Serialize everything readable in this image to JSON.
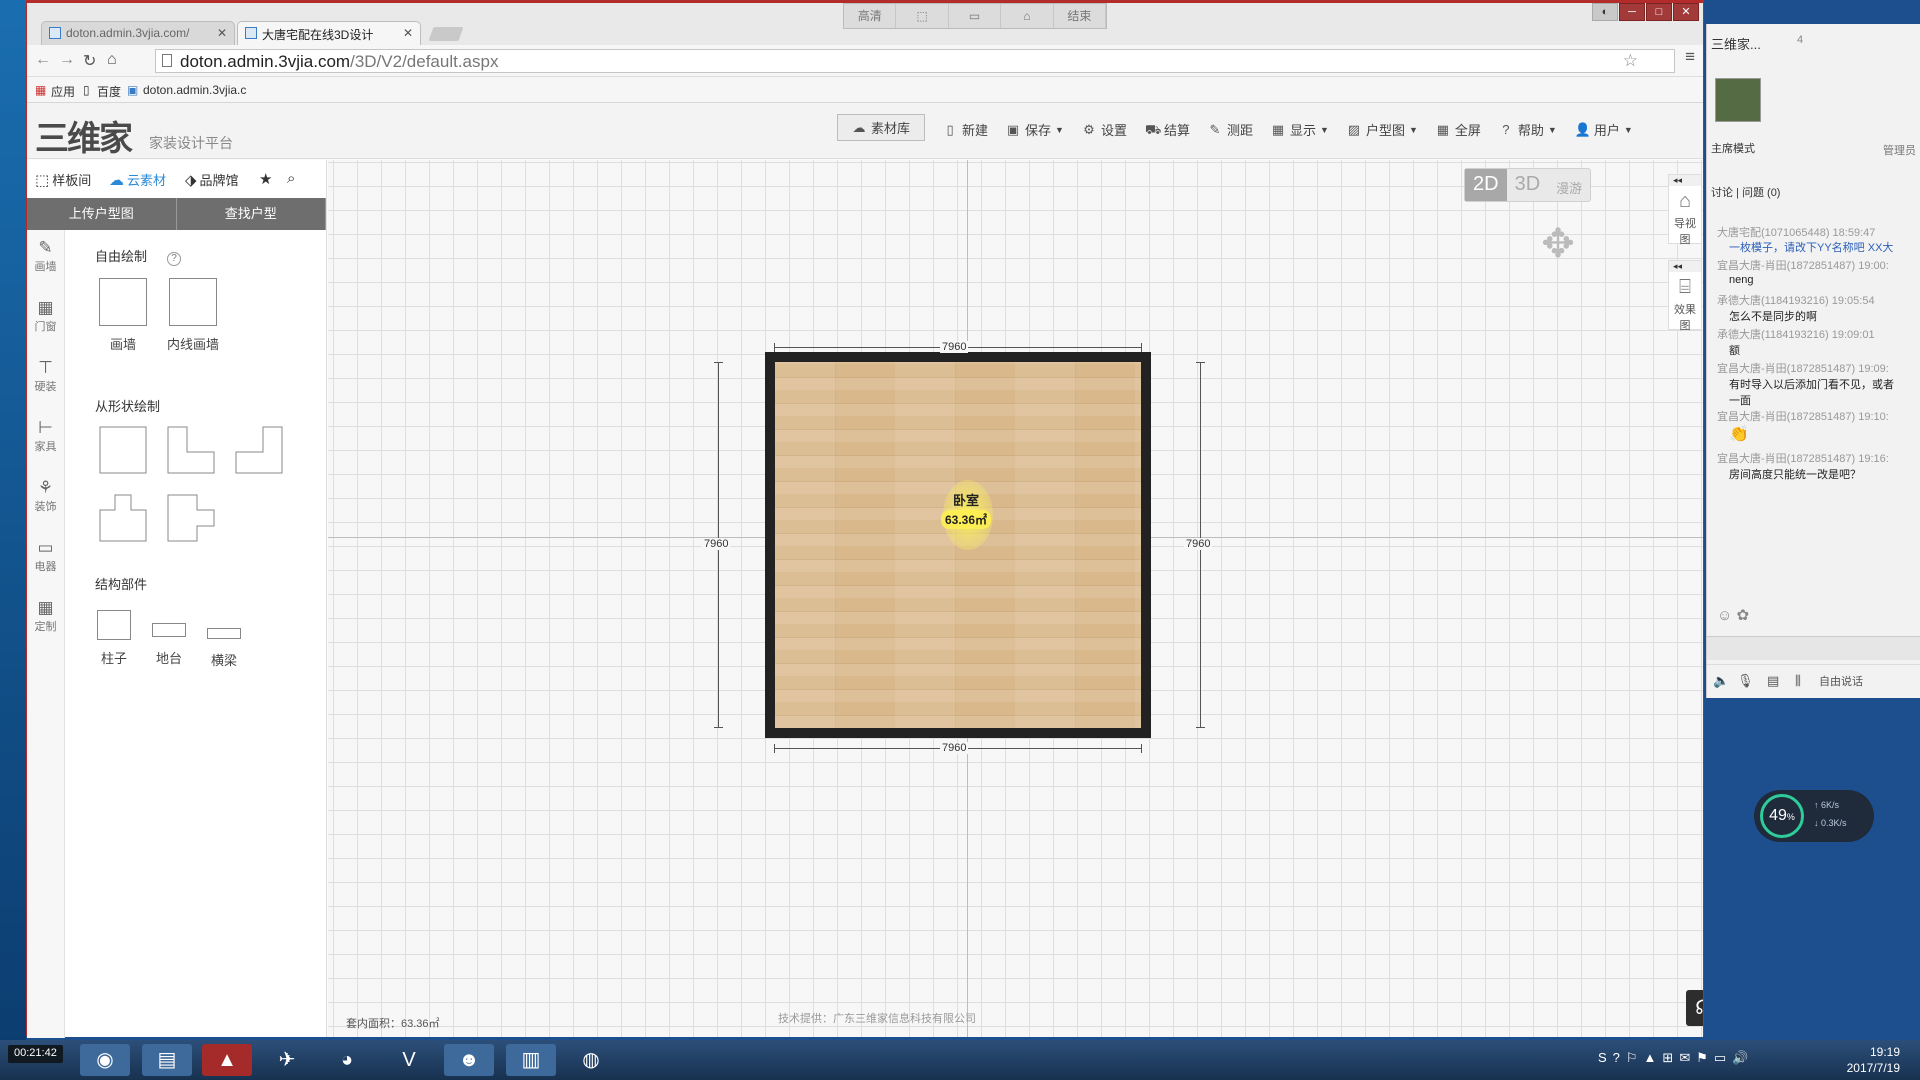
{
  "browser": {
    "tabs": [
      {
        "title": "doton.admin.3vjia.com/"
      },
      {
        "title": "大唐宅配在线3D设计"
      }
    ],
    "record_bar": [
      "高清",
      "",
      "",
      "",
      "结束"
    ],
    "url_host": "doton.admin.3vjia.com",
    "url_path": "/3D/V2/default.aspx",
    "bookmarks": {
      "apps": "应用",
      "baidu": "百度",
      "site": "doton.admin.3vjia.c"
    }
  },
  "app": {
    "logo": "三维家",
    "subtitle": "家装设计平台",
    "toolbar": {
      "library": "素材库",
      "new": "新建",
      "save": "保存",
      "settings": "设置",
      "checkout": "结算",
      "measure": "测距",
      "display": "显示",
      "floorplan": "户型图",
      "fullscreen": "全屏",
      "help": "帮助",
      "user": "用户"
    },
    "left_tabs": {
      "samples": "样板间",
      "cloud": "云素材",
      "brands": "品牌馆"
    },
    "left_buttons": {
      "upload": "上传户型图",
      "find": "查找户型"
    },
    "side_menu": [
      "画墙",
      "门窗",
      "硬装",
      "家具",
      "装饰",
      "电器",
      "定制"
    ],
    "sections": {
      "free_draw": "自由绘制",
      "help_mark": "?",
      "draw_wall": "画墙",
      "inner_wall": "内线画墙",
      "shape_draw": "从形状绘制",
      "structure": "结构部件",
      "pillar": "柱子",
      "platform": "地台",
      "beam": "横梁"
    }
  },
  "canvas": {
    "view_modes": {
      "d2": "2D",
      "d3": "3D",
      "roam": "漫游"
    },
    "room_name": "卧室",
    "room_area": "63.36㎡",
    "dimensions": {
      "top": "7960",
      "bottom": "7960",
      "left": "7960",
      "right": "7960"
    },
    "nav_view": "导视图",
    "render_view": "效果图",
    "area_status": "套内面积：63.36㎡",
    "credit": "技术提供：广东三维家信息科技有限公司"
  },
  "chat": {
    "title": "三维家...",
    "count": "4",
    "mode": "主席模式",
    "admin": "管理员",
    "tabs": "讨论 | 问题 (0)",
    "messages": [
      {
        "meta": "大唐宅配(1071065448) 18:59:47",
        "text": "一枚模子，请改下YY名称吧 XX大"
      },
      {
        "meta": "宜昌大唐-肖田(1872851487) 19:00:",
        "text": "neng"
      },
      {
        "meta": "承德大唐(1184193216) 19:05:54",
        "text": "怎么不是同步的啊"
      },
      {
        "meta": "承德大唐(1184193216) 19:09:01",
        "text": "额"
      },
      {
        "meta": "宜昌大唐-肖田(1872851487) 19:09:",
        "text": "有时导入以后添加门看不见，或者"
      },
      {
        "meta": "",
        "text": "一面"
      },
      {
        "meta": "宜昌大唐-肖田(1872851487) 19:10:",
        "text": ""
      },
      {
        "meta": "宜昌大唐-肖田(1872851487) 19:16:",
        "text": "房间高度只能统一改是吧？"
      }
    ],
    "free_talk": "自由说话"
  },
  "system": {
    "cpu_percent": "49",
    "net_up": "6K/s",
    "net_down": "0.3K/s",
    "rec_timer": "00:21:42",
    "time": "19:19",
    "date": "2017/7/19"
  }
}
